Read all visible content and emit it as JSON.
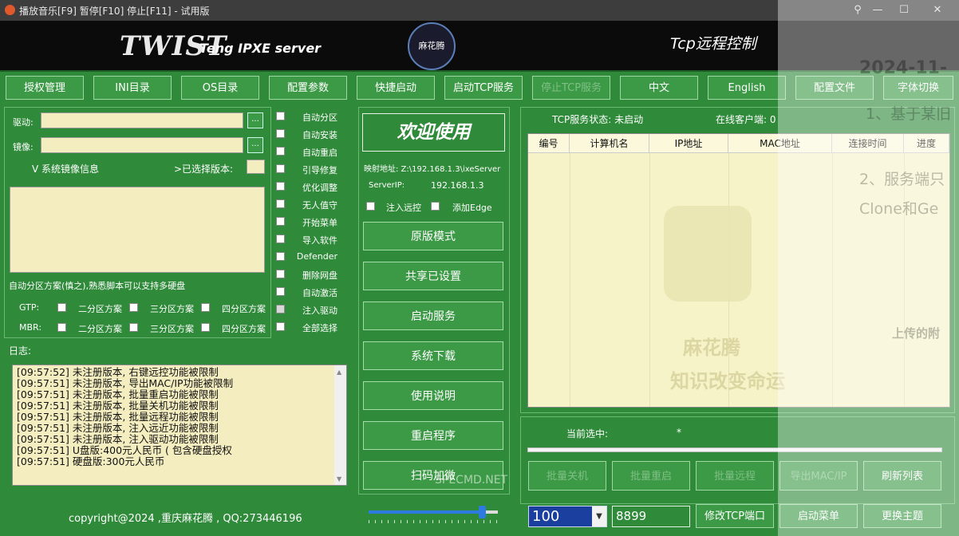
{
  "window": {
    "title": "播放音乐[F9] 暂停[F10] 停止[F11] - 试用版",
    "minimize": "—",
    "maximize": "☐",
    "close": "✕"
  },
  "banner": {
    "logo_main": "TWIST",
    "logo_sub": "Teng IPXE server",
    "emblem": "麻花腾",
    "tcp_title": "Tcp远程控制"
  },
  "toolbar": [
    "授权管理",
    "INI目录",
    "OS目录",
    "配置参数",
    "快捷启动",
    "启动TCP服务",
    "停止TCP服务",
    "中文",
    "English",
    "配置文件",
    "字体切换"
  ],
  "left": {
    "driver_label": "驱动:",
    "image_label": "镜像:",
    "dots": "...",
    "sys_info": "V 系统镜像信息",
    "selected_version": ">已选择版本:",
    "auto_part_hint": "自动分区方案(慎之),熟悉脚本可以支持多硬盘",
    "gtp_label": "GTP:",
    "mbr_label": "MBR:",
    "two_part": "二分区方案",
    "three_part": "三分区方案",
    "four_part": "四分区方案",
    "log_label": "日志:"
  },
  "options": [
    "自动分区",
    "自动安装",
    "自动重启",
    "引导修复",
    "优化调整",
    "无人值守",
    "开始菜单",
    "导入软件",
    "Defender",
    "删除网盘",
    "自动激活",
    "注入驱动",
    "全部选择"
  ],
  "middle": {
    "welcome": "欢迎使用",
    "mapping": "映射地址: Z:\\192.168.1.3\\ixeServer",
    "server_ip_label": "ServerIP:",
    "server_ip": "192.168.1.3",
    "inject_remote": "注入远控",
    "add_edge": "添加Edge",
    "buttons": [
      "原版模式",
      "共享已设置",
      "启动服务",
      "系统下载",
      "使用说明",
      "重启程序",
      "扫码加微"
    ]
  },
  "log": [
    "[09:57:52] 未注册版本, 右键远控功能被限制",
    "[09:57:51] 未注册版本, 导出MAC/IP功能被限制",
    "[09:57:51] 未注册版本, 批量重启功能被限制",
    "[09:57:51] 未注册版本, 批量关机功能被限制",
    "[09:57:51] 未注册版本, 批量远程功能被限制",
    "[09:57:51] 未注册版本, 注入远近功能被限制",
    "[09:57:51] 未注册版本, 注入驱动功能被限制",
    "[09:57:51] U盘版:400元人民币 ( 包含硬盘授权",
    "[09:57:51] 硬盘版:300元人民币"
  ],
  "right": {
    "tcp_status": "TCP服务状态: 未启动",
    "online": "在线客户端: 0",
    "columns": [
      "编号",
      "计算机名",
      "IP地址",
      "MAC地址",
      "连接时间",
      "进度"
    ],
    "watermark_name": "麻花腾",
    "watermark_motto": "知识改变命运",
    "current_selected_label": "当前选中:",
    "current_selected_value": "*",
    "batch_buttons": [
      "批量关机",
      "批量重启",
      "批量远程",
      "导出MAC/IP",
      "刷新列表"
    ]
  },
  "bottom": {
    "copyright": "copyright@2024 ,重庆麻花腾 , QQ:273446196",
    "slider_level": 0.9,
    "combo_value": "100",
    "port_value": "8899",
    "buttons": [
      "修改TCP端口",
      "启动菜单",
      "更换主题"
    ]
  },
  "site_watermark": "SPECMD.NET",
  "overlay_text": [
    "2024-11-",
    "1、基于某旧",
    "2、服务端只",
    "Clone和Ge",
    "上传的附"
  ]
}
